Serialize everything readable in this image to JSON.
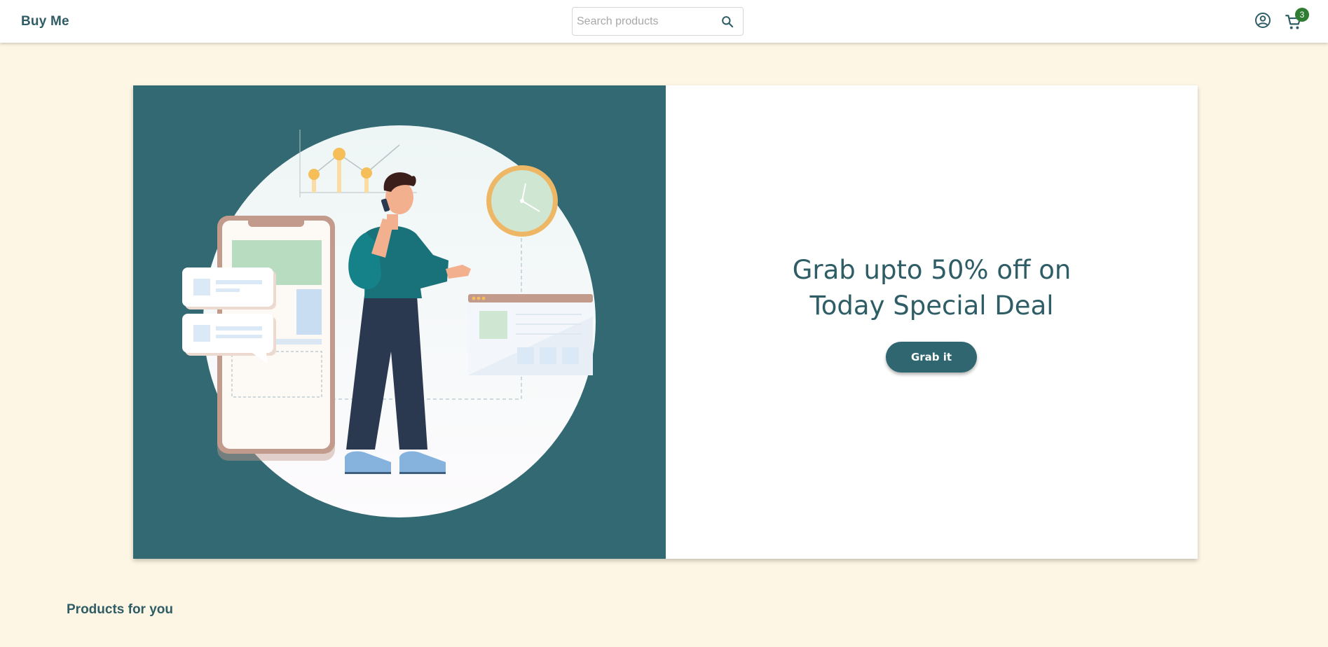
{
  "header": {
    "brand": "Buy Me",
    "search": {
      "placeholder": "Search products",
      "value": ""
    },
    "icons": {
      "search": "search-icon",
      "account": "account-circle-icon",
      "cart": "shopping-cart-icon"
    },
    "cart_count": "3"
  },
  "banner": {
    "headline_line1": "Grab upto 50% off on",
    "headline_line2": "Today Special Deal",
    "cta_label": "Grab it",
    "illustration": "online-shopping-illustration"
  },
  "products_section": {
    "title": "Products for you"
  },
  "colors": {
    "primary": "#336972",
    "page_background": "#fef6e4",
    "badge": "#2e7d32",
    "text": "#2f5d66"
  }
}
